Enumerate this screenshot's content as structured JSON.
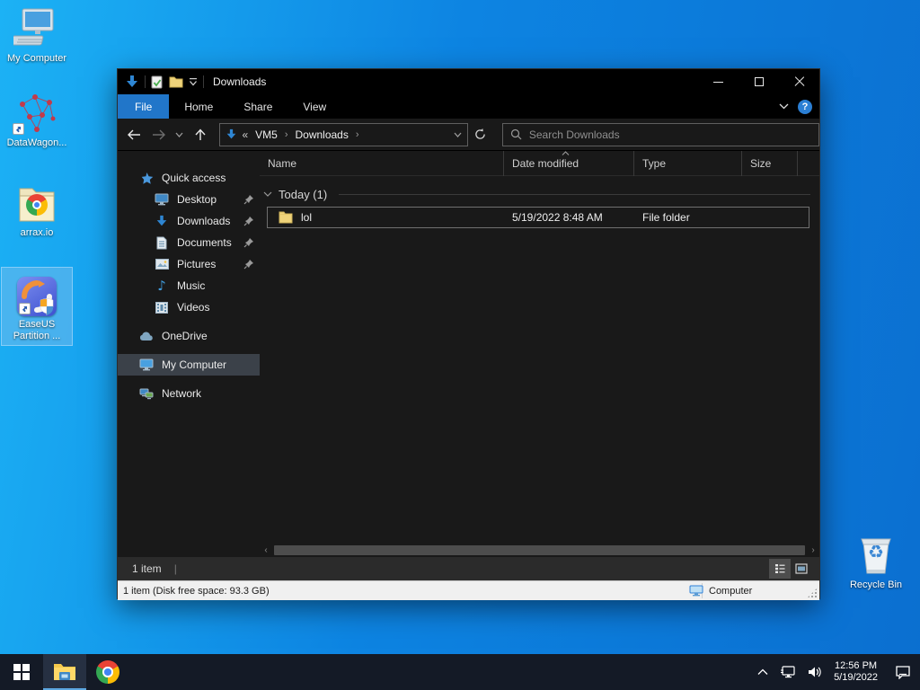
{
  "desktop": {
    "icons": [
      {
        "label": "My Computer"
      },
      {
        "label": "DataWagon..."
      },
      {
        "label": "arrax.io"
      },
      {
        "label": "EaseUS Partition ..."
      },
      {
        "label": "Recycle Bin"
      }
    ]
  },
  "explorer": {
    "title": "Downloads",
    "ribbon": {
      "tabs": [
        "File",
        "Home",
        "Share",
        "View"
      ],
      "help": "?"
    },
    "nav": {
      "address_prefix": "«",
      "crumb_sep": "›",
      "crumbs": [
        "VM5",
        "Downloads"
      ],
      "search_placeholder": "Search Downloads"
    },
    "sidebar": {
      "items": [
        {
          "label": "Quick access"
        },
        {
          "label": "Desktop"
        },
        {
          "label": "Downloads"
        },
        {
          "label": "Documents"
        },
        {
          "label": "Pictures"
        },
        {
          "label": "Music"
        },
        {
          "label": "Videos"
        },
        {
          "label": "OneDrive"
        },
        {
          "label": "My Computer"
        },
        {
          "label": "Network"
        }
      ]
    },
    "list": {
      "columns": [
        "Name",
        "Date modified",
        "Type",
        "Size"
      ],
      "group": "Today (1)",
      "rows": [
        {
          "name": "lol",
          "date_modified": "5/19/2022 8:48 AM",
          "type": "File folder",
          "size": ""
        }
      ]
    },
    "status": {
      "items": "1 item",
      "separator": "|"
    },
    "classic_status": {
      "left": "1 item (Disk free space: 93.3 GB)",
      "right": "Computer"
    },
    "scrollbar": {
      "left_arrow": "‹",
      "right_arrow": "›"
    }
  },
  "taskbar": {
    "clock": {
      "time": "12:56 PM",
      "date": "5/19/2022"
    }
  },
  "glyphs": {
    "music_note": "♪",
    "recycle": "♻"
  },
  "colors": {
    "accent": "#2176c9",
    "folder_yellow": "#efd37a",
    "selection_blue": "#82beeb"
  }
}
